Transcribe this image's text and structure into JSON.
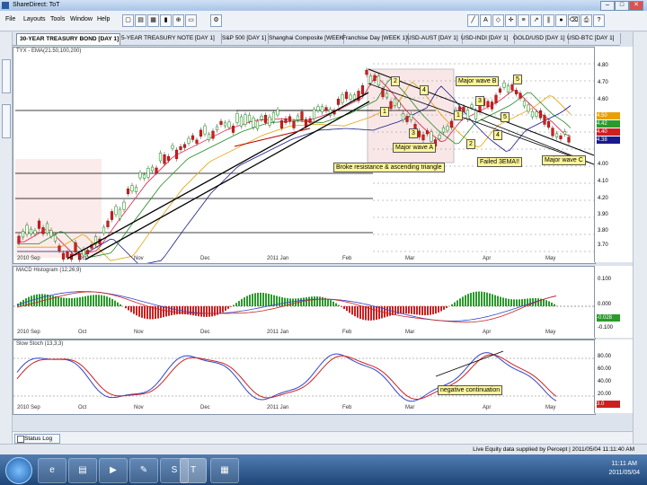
{
  "window": {
    "title": "ShareDirect: ToT"
  },
  "menu": [
    "File",
    "Layouts",
    "Tools",
    "Window",
    "Help"
  ],
  "tabs": [
    {
      "label": "30-YEAR TREASURY BOND [DAY 1]",
      "active": true
    },
    {
      "label": "5-YEAR TREASURY NOTE [DAY 1]",
      "active": false
    },
    {
      "label": "S&P 500 [DAY 1]",
      "active": false
    },
    {
      "label": "Shanghai Composite [WEEK 1]",
      "active": false
    },
    {
      "label": "Franchise Day [WEEK 1]",
      "active": false
    },
    {
      "label": "USD-AUST [DAY 1]",
      "active": false
    },
    {
      "label": "USD-INDI [DAY 1]",
      "active": false
    },
    {
      "label": "GOLD/USD [DAY 1]",
      "active": false
    },
    {
      "label": "USD-BTC [DAY 1]",
      "active": false
    }
  ],
  "price_panel": {
    "title": "TYX - EMA(21.50,100,200)",
    "y_ticks": [
      "4.80",
      "4.70",
      "4.60",
      "4.50",
      "4.40",
      "4.30",
      "4.20",
      "4.10",
      "4.00",
      "3.90",
      "3.80",
      "3.70"
    ],
    "price_labels": [
      {
        "text": "4.50",
        "color": "#e8a000"
      },
      {
        "text": "4.42",
        "color": "#2a9a2a"
      },
      {
        "text": "4.40",
        "color": "#cc2020"
      },
      {
        "text": "4.38",
        "color": "#1a1a8a"
      }
    ],
    "x_labels": [
      "2010 Sep",
      "Oct",
      "Nov",
      "Dec",
      "2011 Jan",
      "Feb",
      "Mar",
      "Apr",
      "May"
    ]
  },
  "annotations": {
    "major_wave_a": "Major wave A",
    "major_wave_b": "Major wave B",
    "major_wave_c": "Major wave C",
    "broke_resistance": "Broke resistance & ascending triangle",
    "failed_ema": "Failed 3EMA!!",
    "negative_continuation": "negative continuation",
    "wave_labels": [
      "1",
      "2",
      "3",
      "4",
      "5",
      "1",
      "2",
      "3",
      "4",
      "5"
    ]
  },
  "macd_panel": {
    "title": "MACD Histogram (12,26,9)",
    "y_ticks": [
      "0.100",
      "0.000",
      "-0.100"
    ],
    "value_label": {
      "text": "-0.028",
      "color": "#2a9a2a"
    },
    "x_labels": [
      "2010 Sep",
      "Oct",
      "Nov",
      "Dec",
      "2011 Jan",
      "Feb",
      "Mar",
      "Apr",
      "May"
    ]
  },
  "stoch_panel": {
    "title": "Slow Stoch (13,3,3)",
    "y_ticks": [
      "80.00",
      "60.00",
      "40.00",
      "20.00"
    ],
    "value_label": {
      "text": "3.0",
      "color": "#cc2020"
    },
    "x_labels": [
      "2010 Sep",
      "Oct",
      "Nov",
      "Dec",
      "2011 Jan",
      "Feb",
      "Mar",
      "Apr",
      "May"
    ]
  },
  "status": {
    "log_button": "Status Log"
  },
  "feed": {
    "text": "Live Equity data supplied by Percept | 2011/05/04 11:11:40 AM"
  },
  "taskbar": {
    "time": "11:11 AM",
    "date": "2011/05/04"
  }
}
